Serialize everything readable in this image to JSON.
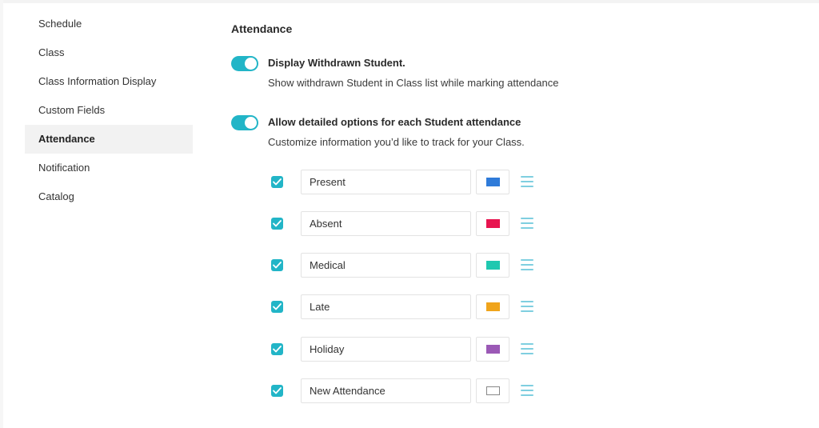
{
  "sidebar": {
    "items": [
      {
        "label": "Schedule"
      },
      {
        "label": "Class"
      },
      {
        "label": "Class Information Display"
      },
      {
        "label": "Custom Fields"
      },
      {
        "label": "Attendance",
        "active": true
      },
      {
        "label": "Notification"
      },
      {
        "label": "Catalog"
      }
    ]
  },
  "main": {
    "title": "Attendance",
    "settings": [
      {
        "label": "Display Withdrawn Student.",
        "description": "Show withdrawn Student in Class list while marking attendance",
        "enabled": true
      },
      {
        "label": "Allow detailed options for each Student attendance",
        "description": "Customize information you’d like to track for your Class.",
        "enabled": true
      }
    ],
    "options": [
      {
        "value": "Present",
        "checked": true,
        "color": "#2f7bd9"
      },
      {
        "value": "Absent",
        "checked": true,
        "color": "#e8144f"
      },
      {
        "value": "Medical",
        "checked": true,
        "color": "#1fc8b0"
      },
      {
        "value": "Late",
        "checked": true,
        "color": "#f0a41b"
      },
      {
        "value": "Holiday",
        "checked": true,
        "color": "#9b59b6"
      },
      {
        "value": "New Attendance",
        "checked": true,
        "color": "#ffffff"
      }
    ]
  },
  "colors": {
    "accent": "#22b5c7",
    "drag_handle": "#7fcfe0"
  },
  "icons": {
    "checkbox": "check-icon",
    "drag": "drag-handle-icon"
  }
}
